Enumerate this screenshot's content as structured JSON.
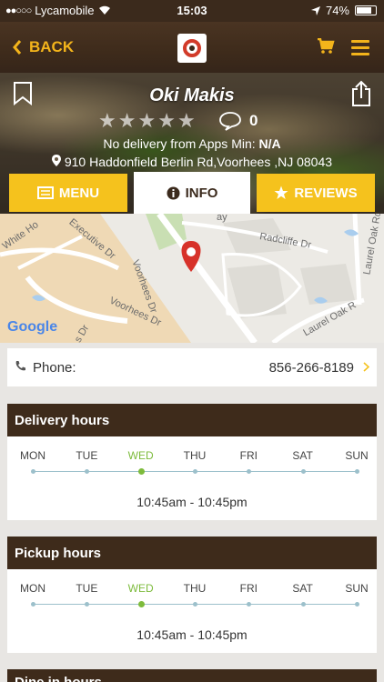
{
  "status_bar": {
    "carrier": "Lycamobile",
    "time": "15:03",
    "battery": "74%"
  },
  "nav": {
    "back_label": "BACK"
  },
  "restaurant": {
    "name": "Oki Makis",
    "rating_stars": 0,
    "rating_max": 5,
    "comment_count": "0",
    "delivery_text": "No delivery from Apps",
    "min_label": "Min:",
    "min_value": "N/A",
    "address": "910 Haddonfield Berlin Rd,Voorhees ,NJ 08043"
  },
  "tabs": [
    {
      "label": "MENU",
      "icon": "menu-list-icon",
      "active": false
    },
    {
      "label": "INFO",
      "icon": "info-circle-icon",
      "active": true
    },
    {
      "label": "REVIEWS",
      "icon": "star-icon",
      "active": false
    }
  ],
  "map": {
    "labels": {
      "executive": "Executive Dr",
      "white_ho": "White Ho",
      "radcliffe": "Radcliffe Dr",
      "laurel_oak_rd": "Laurel Oak Rd",
      "laurel_oak_r": "Laurel Oak R",
      "voorhees": "Voorhees Dr",
      "voorhees_dr2": "Voorhees Dr",
      "s_dr": "s Dr",
      "ay": "ay"
    },
    "google": "Google"
  },
  "phone": {
    "label": "Phone:",
    "value": "856-266-8189"
  },
  "delivery_hours": {
    "title": "Delivery hours",
    "days": [
      "MON",
      "TUE",
      "WED",
      "THU",
      "FRI",
      "SAT",
      "SUN"
    ],
    "active_day": "WED",
    "hours": "10:45am - 10:45pm"
  },
  "pickup_hours": {
    "title": "Pickup hours",
    "days": [
      "MON",
      "TUE",
      "WED",
      "THU",
      "FRI",
      "SAT",
      "SUN"
    ],
    "active_day": "WED",
    "hours": "10:45am - 10:45pm"
  },
  "next_section": {
    "title": "Dine in hours"
  },
  "colors": {
    "brand_brown": "#3e2b1b",
    "accent_yellow": "#f5c21d",
    "active_green": "#7dbb3c",
    "pin_red": "#d23b2a"
  }
}
